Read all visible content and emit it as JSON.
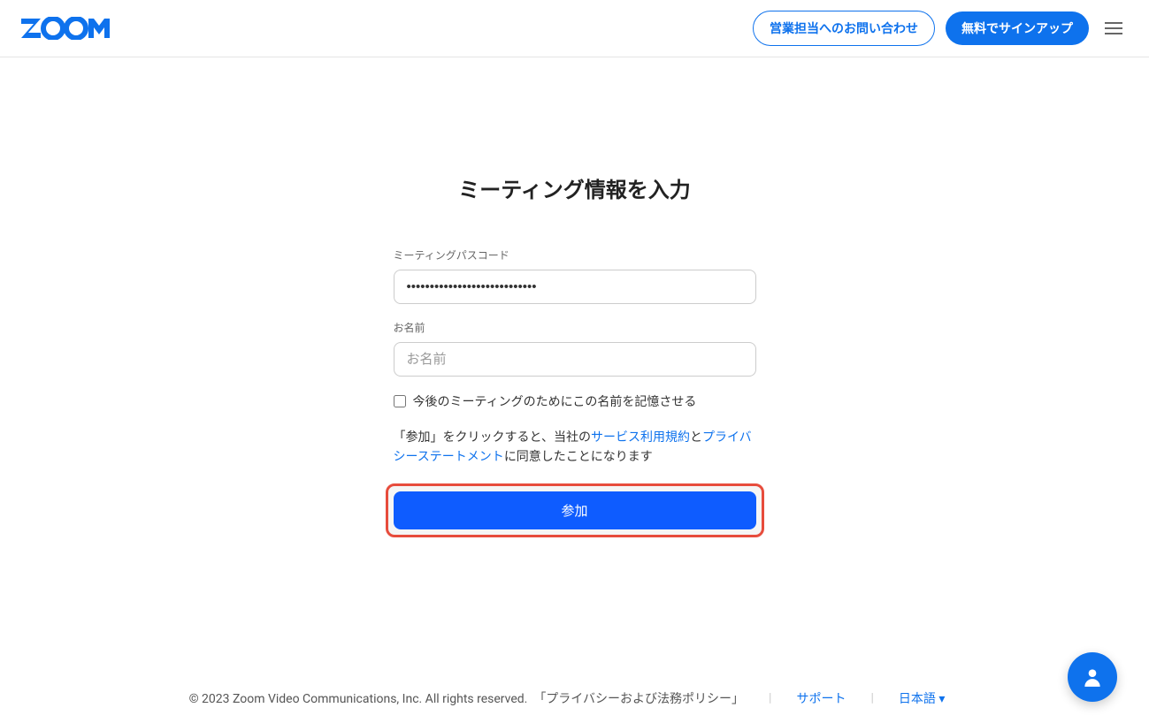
{
  "header": {
    "contact_label": "営業担当へのお問い合わせ",
    "signup_label": "無料でサインアップ"
  },
  "form": {
    "title": "ミーティング情報を入力",
    "passcode_label": "ミーティングパスコード",
    "passcode_value": "••••••••••••••••••••••••••••",
    "name_label": "お名前",
    "name_placeholder": "お名前",
    "remember_label": "今後のミーティングのためにこの名前を記憶させる",
    "consent_prefix": "「参加」をクリックすると、当社の",
    "terms_link": "サービス利用規約",
    "consent_mid": "と",
    "privacy_link": "プライバシーステートメント",
    "consent_suffix": "に同意したことになります",
    "join_label": "参加"
  },
  "footer": {
    "copyright": "© 2023 Zoom Video Communications, Inc. All rights reserved.",
    "policy_link": "「プライバシーおよび法務ポリシー」",
    "support_link": "サポート",
    "language": "日本語"
  }
}
